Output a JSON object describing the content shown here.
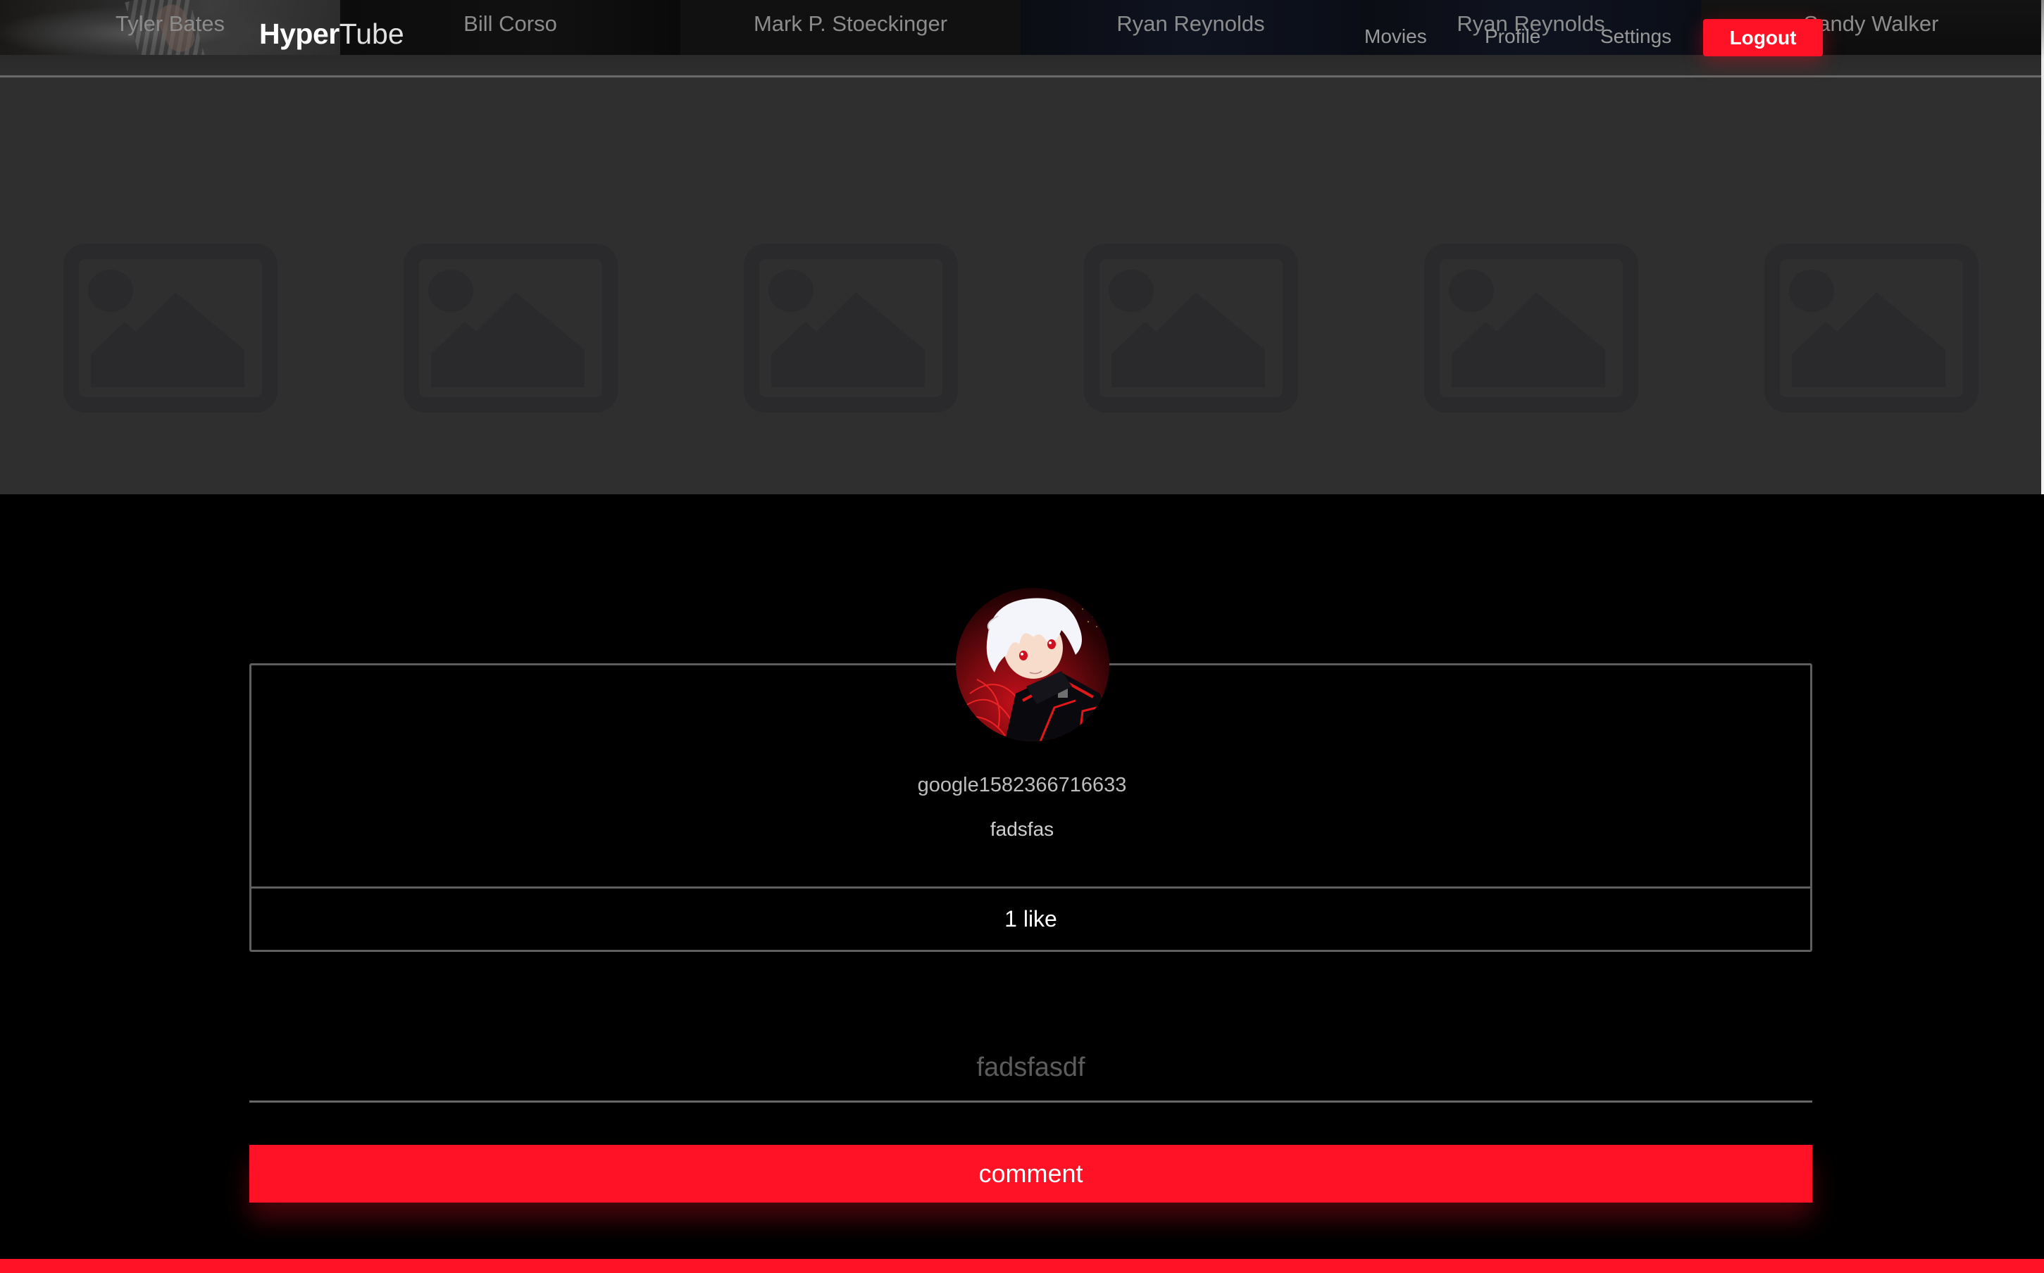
{
  "app": {
    "logo_bold": "Hyper",
    "logo_thin": "Tube"
  },
  "nav": {
    "movies": "Movies",
    "profile": "Profile",
    "settings": "Settings",
    "logout": "Logout"
  },
  "cast": [
    {
      "name": "Tyler Bates",
      "image": "photo"
    },
    {
      "name": "Bill Corso",
      "image": "photo"
    },
    {
      "name": "Mark P. Stoeckinger",
      "image": "photo"
    },
    {
      "name": "Ryan Reynolds",
      "image": "photo"
    },
    {
      "name": "Ryan Reynolds",
      "image": "photo"
    },
    {
      "name": "Sandy Walker",
      "image": "photo"
    }
  ],
  "cast_placeholders": {
    "icon": "image-placeholder-icon",
    "count": 6
  },
  "comment": {
    "avatar_icon": "user-avatar",
    "username": "google1582366716633",
    "text": "fadsfas",
    "likes_label": "1 like"
  },
  "comment_form": {
    "placeholder": "fadsfasdf",
    "value": "",
    "submit_label": "comment"
  },
  "colors": {
    "accent": "#ff1126",
    "background": "#000000",
    "cast_section_bg": "#2f2f2f",
    "border": "#5e5e5e"
  }
}
